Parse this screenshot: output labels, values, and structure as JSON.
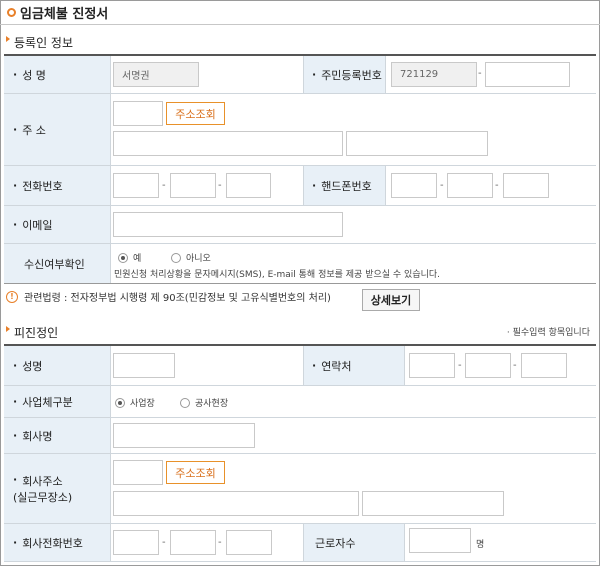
{
  "page_title": "임금체불 진정서",
  "sections": {
    "registrant": "등록인 정보",
    "respondent": "피진정인"
  },
  "registrant": {
    "name_label": "성 명",
    "name_value": "서명권",
    "rrn_label": "주민등록번호",
    "rrn_front": "721129",
    "rrn_back": "",
    "address_label": "주 소",
    "address_search_button": "주소조회",
    "phone_label": "전화번호",
    "mobile_label": "핸드폰번호",
    "email_label": "이메일",
    "consent_label": "수신여부확인",
    "consent_yes": "예",
    "consent_no": "아니오",
    "consent_selected": "예",
    "consent_notice": "민원신청 처리상황을 문자메시지(SMS), E-mail 통해 정보를 제공 받으실 수 있습니다."
  },
  "law": {
    "text": "관련법령 : 전자정부법 시행령 제 90조(민감정보 및 고유식별번호의 처리)",
    "detail_button": "상세보기"
  },
  "respondent": {
    "required_note": "· 필수입력 항목입니다",
    "name_label": "성명",
    "contact_label": "연락처",
    "business_type_label": "사업체구분",
    "business_option_1": "사업장",
    "business_option_2": "공사현장",
    "business_selected": "사업장",
    "company_label": "회사명",
    "company_address_label_1": "회사주소",
    "company_address_label_2": "(실근무장소)",
    "address_search_button": "주소조회",
    "company_phone_label": "회사전화번호",
    "workers_label": "근로자수",
    "workers_unit": "명"
  },
  "separator": "-"
}
